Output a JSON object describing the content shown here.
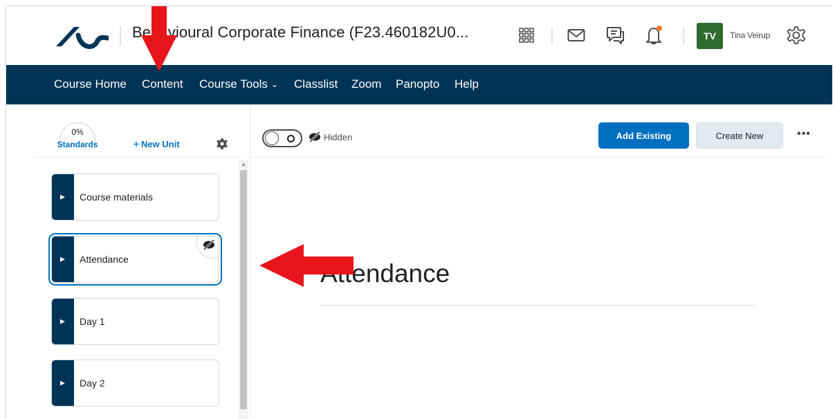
{
  "header": {
    "course_title": "Behavioural Corporate Finance (F23.460182U0...",
    "user_initials": "TV",
    "user_name": "Tina Veirup",
    "avatar_color": "#2e6b30",
    "notification_dot_color": "#f47b20",
    "icons": [
      "waffle-icon",
      "mail-icon",
      "chat-icon",
      "bell-icon",
      "settings-gear-icon"
    ]
  },
  "nav": {
    "background": "#003456",
    "items": [
      {
        "label": "Course Home"
      },
      {
        "label": "Content"
      },
      {
        "label": "Course Tools",
        "dropdown": true
      },
      {
        "label": "Classlist"
      },
      {
        "label": "Zoom"
      },
      {
        "label": "Panopto"
      },
      {
        "label": "Help"
      }
    ]
  },
  "sidebar": {
    "standards_percent": "0%",
    "standards_label": "Standards",
    "new_unit_label": "New Unit",
    "units": [
      {
        "label": "Course materials",
        "selected": false,
        "hidden": false
      },
      {
        "label": "Attendance",
        "selected": true,
        "hidden": true
      },
      {
        "label": "Day 1",
        "selected": false,
        "hidden": false
      },
      {
        "label": "Day 2",
        "selected": false,
        "hidden": false
      }
    ]
  },
  "main": {
    "visibility_label": "Hidden",
    "add_existing_label": "Add Existing",
    "create_new_label": "Create New",
    "more_label": "•••",
    "heading": "Attendance",
    "accent": "#006fbf"
  },
  "annotations": {
    "arrow_color": "#e8161c"
  }
}
